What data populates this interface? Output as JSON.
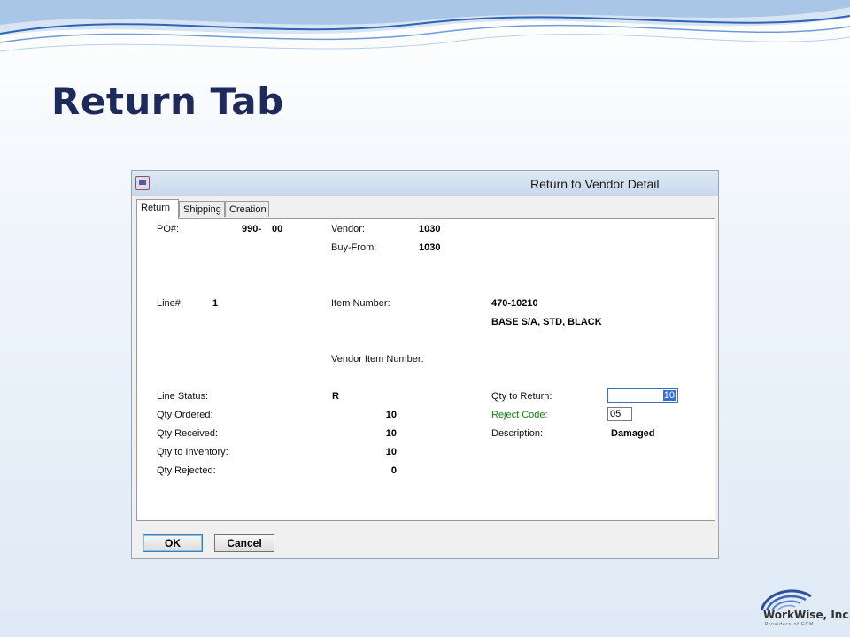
{
  "slide": {
    "title": "Return Tab"
  },
  "window": {
    "title": "Return to Vendor Detail"
  },
  "tabs": [
    {
      "label": "Return",
      "active": true
    },
    {
      "label": "Shipping",
      "active": false
    },
    {
      "label": "Creation",
      "active": false
    }
  ],
  "header": {
    "po_label": "PO#:",
    "po_value": "990-",
    "po_suffix": "00",
    "vendor_label": "Vendor:",
    "vendor_value": "1030",
    "buyfrom_label": "Buy-From:",
    "buyfrom_value": "1030"
  },
  "line": {
    "line_label": "Line#:",
    "line_value": "1",
    "item_label": "Item Number:",
    "item_value": "470-10210",
    "item_desc": "BASE S/A, STD, BLACK",
    "vendor_item_label": "Vendor Item Number:"
  },
  "status": {
    "line_status_label": "Line Status:",
    "line_status_value": "R",
    "qty_ordered_label": "Qty Ordered:",
    "qty_ordered_value": "10",
    "qty_received_label": "Qty Received:",
    "qty_received_value": "10",
    "qty_inventory_label": "Qty to Inventory:",
    "qty_inventory_value": "10",
    "qty_rejected_label": "Qty Rejected:",
    "qty_rejected_value": "0"
  },
  "returns": {
    "qty_return_label": "Qty to Return:",
    "qty_return_value": "10",
    "reject_code_label": "Reject Code:",
    "reject_code_value": "05",
    "description_label": "Description:",
    "description_value": "Damaged"
  },
  "buttons": {
    "ok": "OK",
    "cancel": "Cancel"
  },
  "logo": {
    "name": "WorkWise, Inc.",
    "tagline": "Providers of ECM"
  },
  "colors": {
    "title": "#1f2a5c",
    "reject_label": "#1d7a1d",
    "selection": "#3171d2"
  }
}
